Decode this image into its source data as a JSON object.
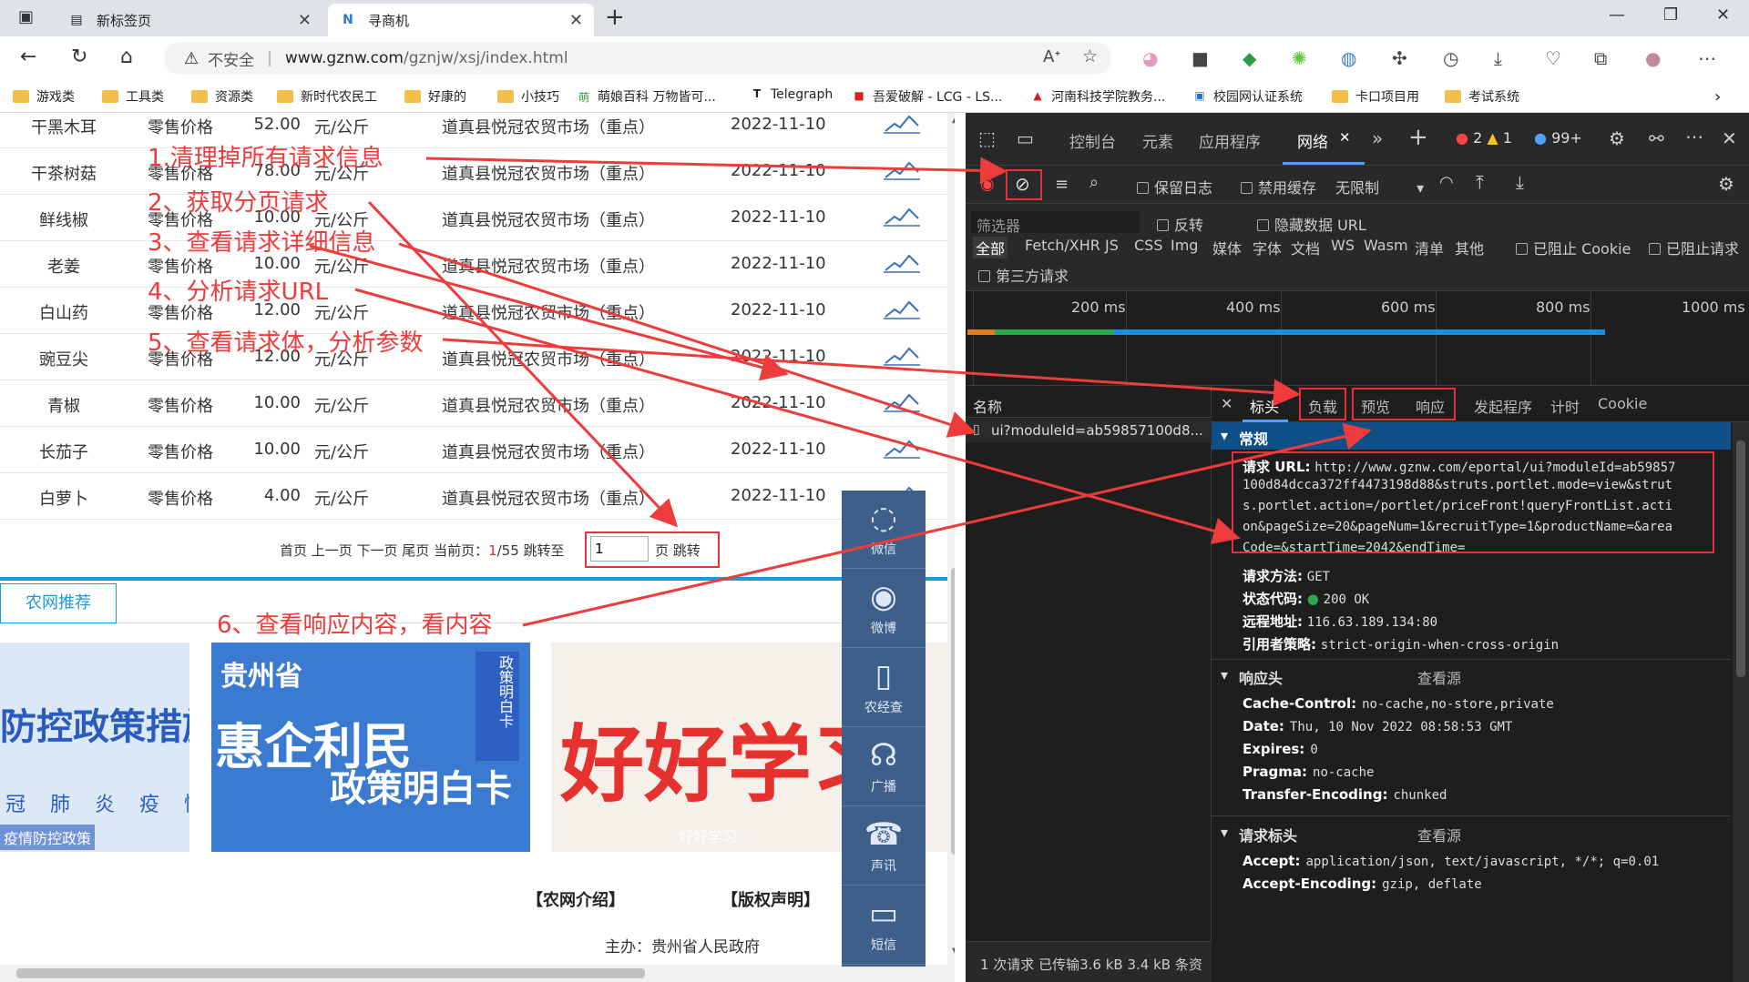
{
  "browser": {
    "tabs": [
      {
        "title": "新标签页"
      },
      {
        "title": "寻商机"
      }
    ],
    "address": {
      "warning": "不安全",
      "domain": "www.gznw.com",
      "path": "/gznjw/xsj/index.html"
    },
    "bookmarks": [
      "游戏类",
      "工具类",
      "资源类",
      "新时代农民工",
      "好康的",
      "小技巧",
      "萌娘百科 万物皆可...",
      "Telegraph",
      "吾爱破解 - LCG - LS...",
      "河南科技学院教务...",
      "校园网认证系统",
      "卡口项目用",
      "考试系统"
    ]
  },
  "prices": {
    "rows": [
      {
        "name": "干黑木耳",
        "type": "零售价格",
        "price": "52.00",
        "unit": "元/公斤",
        "market": "道真县悦冠农贸市场（重点）",
        "date": "2022-11-10"
      },
      {
        "name": "干茶树菇",
        "type": "零售价格",
        "price": "78.00",
        "unit": "元/公斤",
        "market": "道真县悦冠农贸市场（重点）",
        "date": "2022-11-10"
      },
      {
        "name": "鲜线椒",
        "type": "零售价格",
        "price": "10.00",
        "unit": "元/公斤",
        "market": "道真县悦冠农贸市场（重点）",
        "date": "2022-11-10"
      },
      {
        "name": "老姜",
        "type": "零售价格",
        "price": "10.00",
        "unit": "元/公斤",
        "market": "道真县悦冠农贸市场（重点）",
        "date": "2022-11-10"
      },
      {
        "name": "白山药",
        "type": "零售价格",
        "price": "12.00",
        "unit": "元/公斤",
        "market": "道真县悦冠农贸市场（重点）",
        "date": "2022-11-10"
      },
      {
        "name": "豌豆尖",
        "type": "零售价格",
        "price": "12.00",
        "unit": "元/公斤",
        "market": "道真县悦冠农贸市场（重点）",
        "date": "2022-11-10"
      },
      {
        "name": "青椒",
        "type": "零售价格",
        "price": "10.00",
        "unit": "元/公斤",
        "market": "道真县悦冠农贸市场（重点）",
        "date": "2022-11-10"
      },
      {
        "name": "长茄子",
        "type": "零售价格",
        "price": "10.00",
        "unit": "元/公斤",
        "market": "道真县悦冠农贸市场（重点）",
        "date": "2022-11-10"
      },
      {
        "name": "白萝卜",
        "type": "零售价格",
        "price": "4.00",
        "unit": "元/公斤",
        "market": "道真县悦冠农贸市场（重点）",
        "date": "2022-11-10"
      }
    ],
    "pager": {
      "links": "首页 上一页 下一页 尾页 当前页：",
      "current": "1",
      "total": "/55 跳转至",
      "input": "1",
      "page_label": "页",
      "jump": "跳转"
    }
  },
  "recommend": {
    "tab": "农网推荐",
    "banner1": {
      "lines": [
        "防控政策措施"
      ],
      "caption": "疫情防控政策",
      "small": "冠 肺 炎 疫 情"
    },
    "banner2": {
      "province": "贵州省",
      "headline": "惠企利民",
      "sub": "政策明白卡",
      "side": "政策明白卡"
    },
    "banner3": {
      "headline": "好好学习",
      "caption": "好好学习"
    }
  },
  "footer": {
    "intro": "【农网介绍】",
    "copyright": "【版权声明】",
    "host": "主办：贵州省人民政府"
  },
  "sidebar": [
    {
      "label": "微信",
      "icon": "wechat-icon",
      "glyph": "◌"
    },
    {
      "label": "微博",
      "icon": "weibo-icon",
      "glyph": "◉"
    },
    {
      "label": "农经查",
      "icon": "phone-icon",
      "glyph": "▯"
    },
    {
      "label": "广播",
      "icon": "headset-icon",
      "glyph": "☊"
    },
    {
      "label": "声讯",
      "icon": "telephone-icon",
      "glyph": "☎"
    },
    {
      "label": "短信",
      "icon": "message-icon",
      "glyph": "▭"
    }
  ],
  "annotations": [
    "1.清理掉所有请求信息",
    "2、获取分页请求",
    "3、查看请求详细信息",
    "4、分析请求URL",
    "5、查看请求体，分析参数",
    "6、查看响应内容，看内容"
  ],
  "devtools": {
    "tabs": [
      "控制台",
      "元素",
      "应用程序",
      "网络"
    ],
    "errors": "2",
    "warnings": "1",
    "messages": "99+",
    "toolbar": {
      "preserve_log": "保留日志",
      "disable_cache": "禁用缓存",
      "throttle": "无限制"
    },
    "filter": {
      "placeholder": "筛选器",
      "invert": "反转",
      "hide_data": "隐藏数据 URL"
    },
    "types": [
      "全部",
      "Fetch/XHR",
      "JS",
      "CSS",
      "Img",
      "媒体",
      "字体",
      "文档",
      "WS",
      "Wasm",
      "清单",
      "其他"
    ],
    "blocked_cookie": "已阻止 Cookie",
    "blocked_req": "已阻止请求",
    "third_party": "第三方请求",
    "ticks": [
      "200 ms",
      "400 ms",
      "600 ms",
      "800 ms",
      "1000 ms"
    ],
    "name_header": "名称",
    "request_name": "ui?moduleId=ab59857100d8...",
    "detail_tabs": [
      "标头",
      "负载",
      "预览",
      "响应",
      "发起程序",
      "计时",
      "Cookie"
    ],
    "general": {
      "title": "常规",
      "url_label": "请求 URL:",
      "url_lines": [
        "http://www.gznw.com/eportal/ui?moduleId=ab59857",
        "100d84dcca372ff4473198d88&struts.portlet.mode=view&strut",
        "s.portlet.action=/portlet/priceFront!queryFrontList.acti",
        "on&pageSize=20&pageNum=1&recruitType=1&productName=&area",
        "Code=&startTime=2042&endTime="
      ],
      "method_label": "请求方法:",
      "method": "GET",
      "status_label": "状态代码:",
      "status": "200 OK",
      "remote_label": "远程地址:",
      "remote": "116.63.189.134:80",
      "policy_label": "引用者策略:",
      "policy": "strict-origin-when-cross-origin"
    },
    "response_headers": {
      "title": "响应头",
      "view_source": "查看源",
      "items": [
        {
          "k": "Cache-Control:",
          "v": "no-cache,no-store,private"
        },
        {
          "k": "Date:",
          "v": "Thu, 10 Nov 2022 08:58:53 GMT"
        },
        {
          "k": "Expires:",
          "v": "0"
        },
        {
          "k": "Pragma:",
          "v": "no-cache"
        },
        {
          "k": "Transfer-Encoding:",
          "v": "chunked"
        }
      ]
    },
    "request_headers": {
      "title": "请求标头",
      "view_source": "查看源",
      "items": [
        {
          "k": "Accept:",
          "v": "application/json, text/javascript, */*; q=0.01"
        },
        {
          "k": "Accept-Encoding:",
          "v": "gzip, deflate"
        }
      ]
    },
    "status": "1 次请求  已传输3.6 kB  3.4 kB 条资"
  },
  "colors": {
    "annotation": "#ee3b3b",
    "accent": "#1a9bd7",
    "devtools_bg": "#1e1e1e",
    "devtools_selected": "#0f4f87"
  }
}
